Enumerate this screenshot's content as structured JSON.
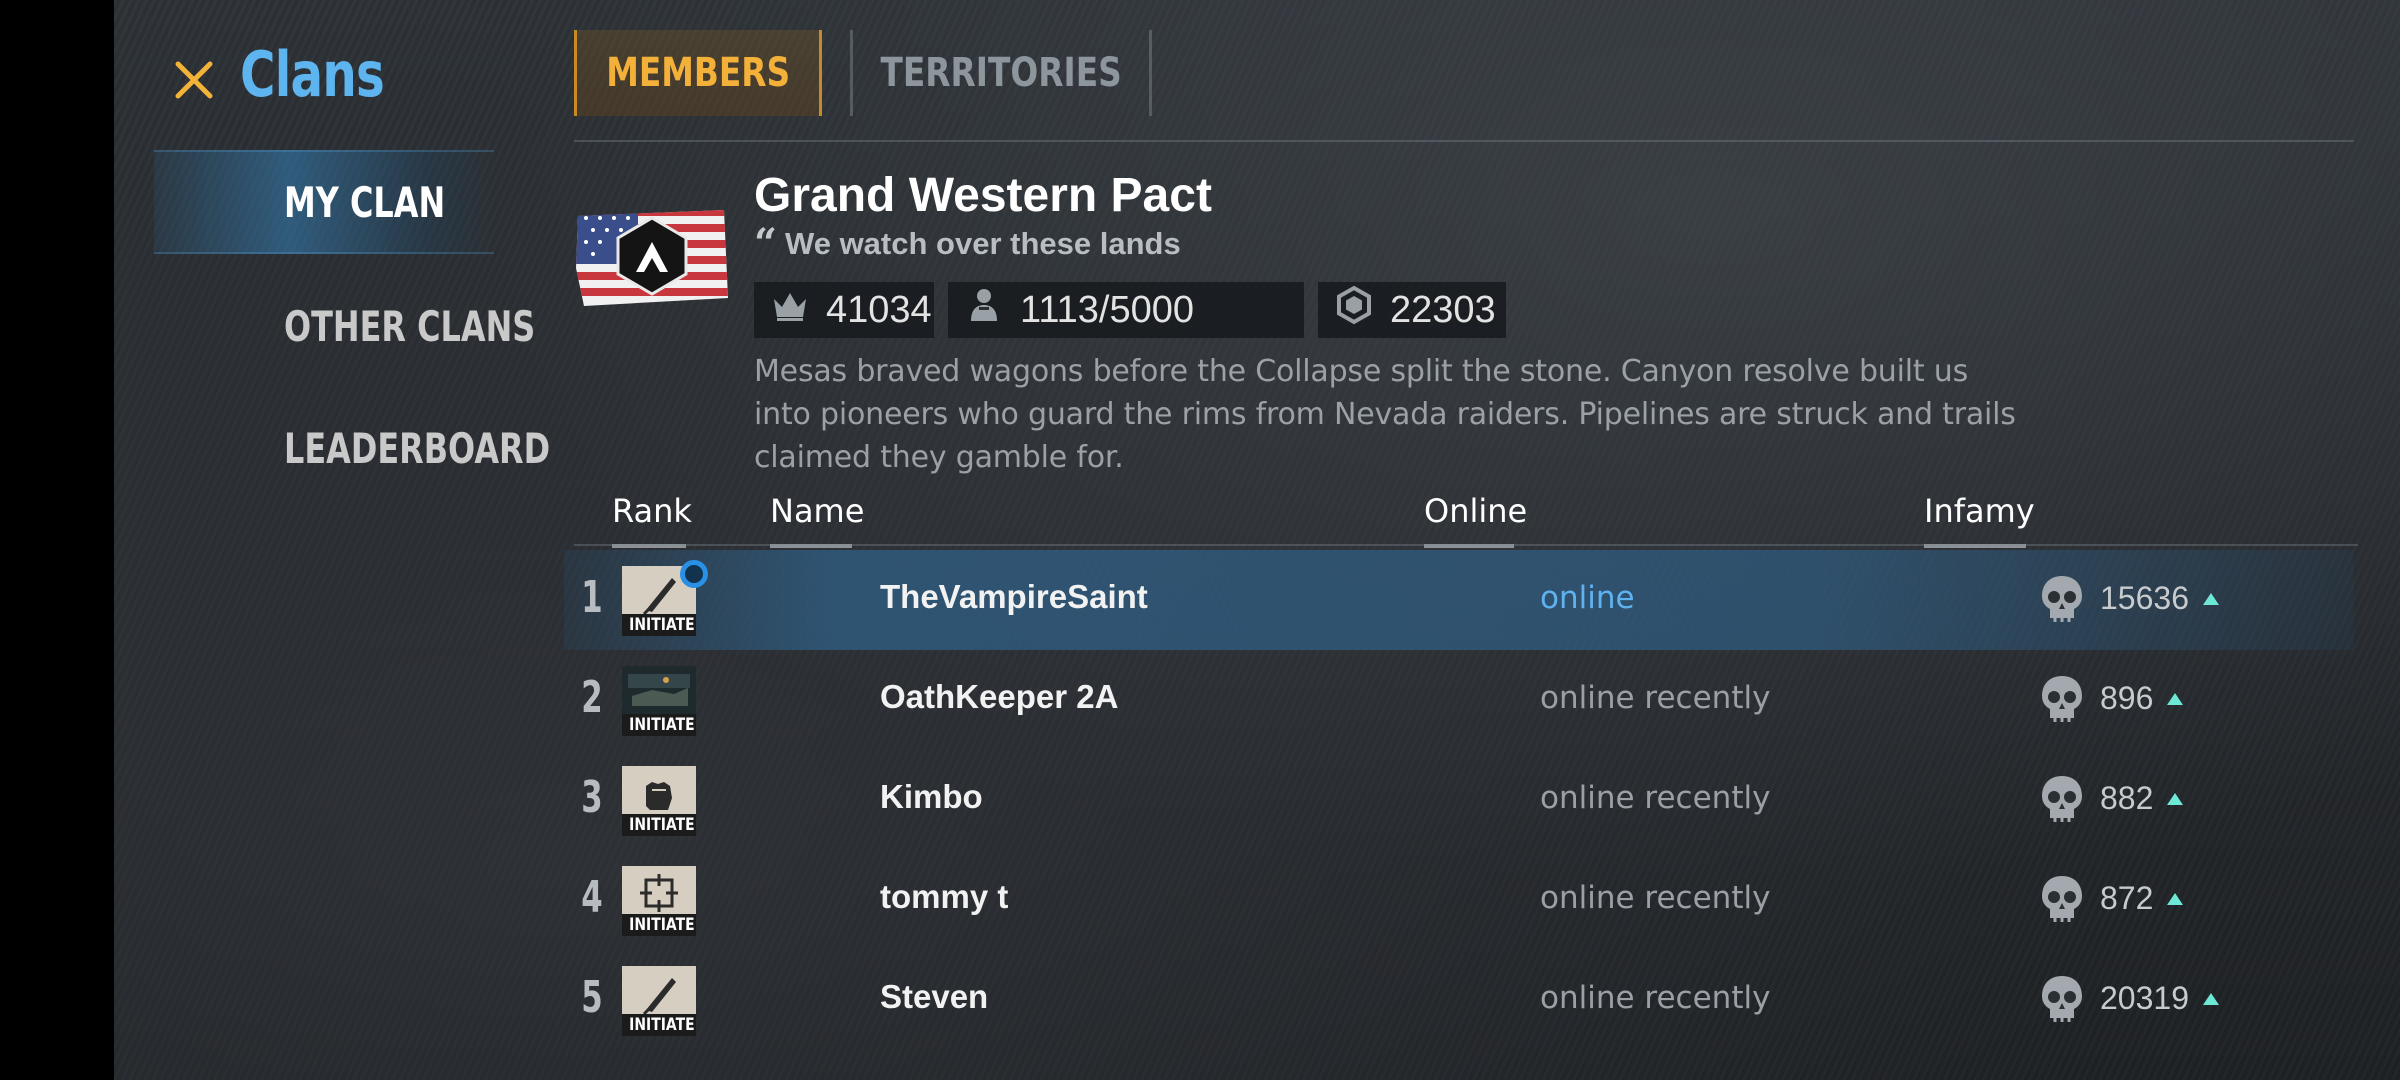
{
  "sidebar": {
    "title": "Clans",
    "close_icon": "close-icon",
    "items": [
      {
        "label": "MY CLAN",
        "active": true
      },
      {
        "label": "OTHER CLANS",
        "active": false
      },
      {
        "label": "LEADERBOARD",
        "active": false
      }
    ]
  },
  "tabs": [
    {
      "label": "MEMBERS",
      "active": true
    },
    {
      "label": "TERRITORIES",
      "active": false
    }
  ],
  "clan": {
    "name": "Grand Western Pact",
    "motto": "We watch over these lands",
    "stats": [
      {
        "icon": "crown-icon",
        "value": "41034"
      },
      {
        "icon": "member-icon",
        "value": "1113/5000"
      },
      {
        "icon": "hexagon-icon",
        "value": "22303"
      }
    ],
    "description": "Mesas braved wagons before the Collapse split the stone. Canyon resolve built us into pioneers who guard the rims from Nevada raiders. Pipelines are struck and trails claimed they gamble for."
  },
  "table": {
    "headers": {
      "rank": "Rank",
      "name": "Name",
      "online": "Online",
      "infamy": "Infamy"
    },
    "rows": [
      {
        "rank": "1",
        "badge": "INITIATE",
        "name": "TheVampireSaint",
        "status": "online",
        "infamy": "15636",
        "action_icon": "leave-clan-icon"
      },
      {
        "rank": "2",
        "badge": "INITIATE",
        "name": "OathKeeper 2A",
        "status": "online recently",
        "infamy": "896",
        "action_icon": "message-icon"
      },
      {
        "rank": "3",
        "badge": "INITIATE",
        "name": "Kimbo",
        "status": "online recently",
        "infamy": "882",
        "action_icon": "message-icon"
      },
      {
        "rank": "4",
        "badge": "INITIATE",
        "name": "tommy t",
        "status": "online recently",
        "infamy": "872",
        "action_icon": "message-icon"
      },
      {
        "rank": "5",
        "badge": "INITIATE",
        "name": "Steven",
        "status": "online recently",
        "infamy": "20319",
        "action_icon": "message-icon"
      }
    ]
  },
  "colors": {
    "accent_blue": "#5db4ef",
    "accent_orange": "#f4b13a",
    "trend_up": "#6ee8d6"
  }
}
